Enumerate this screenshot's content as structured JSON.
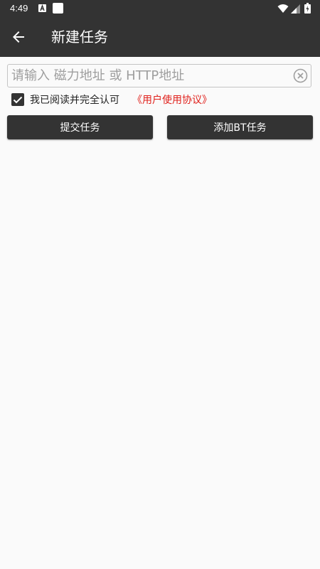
{
  "status_bar": {
    "time": "4:49"
  },
  "app_bar": {
    "title": "新建任务",
    "back_icon": "arrow-left-icon"
  },
  "url_input": {
    "value": "",
    "placeholder": "请输入 磁力地址 或 HTTP地址",
    "clear_icon": "clear-circle-icon"
  },
  "agreement": {
    "checked": true,
    "text": "我已阅读并完全认可",
    "link": "《用户使用协议》",
    "link_color": "#e0201b"
  },
  "buttons": {
    "submit_label": "提交任务",
    "add_bt_label": "添加BT任务"
  },
  "colors": {
    "primary": "#333333",
    "background": "#fafafa"
  }
}
